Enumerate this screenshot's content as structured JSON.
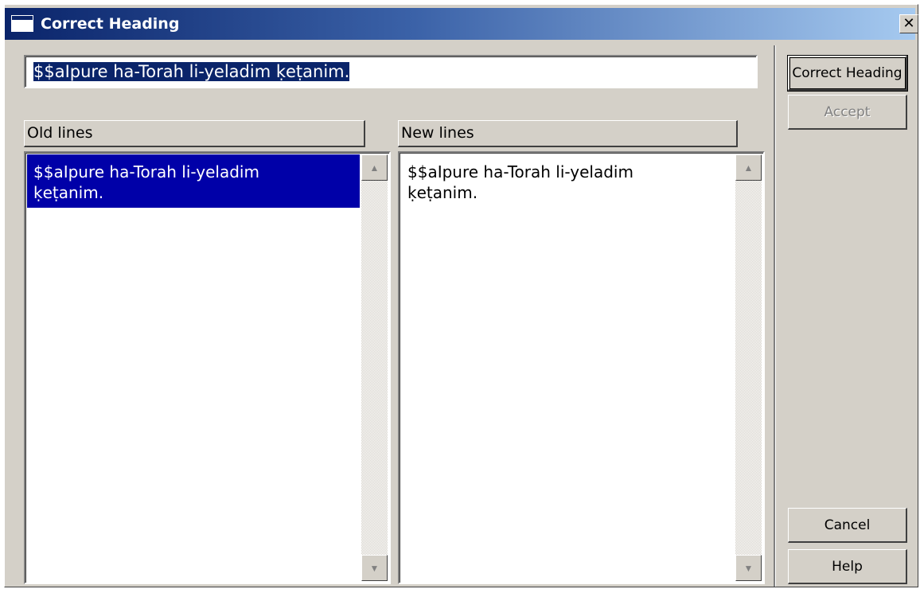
{
  "window": {
    "title": "Correct Heading",
    "close_label": "✕"
  },
  "heading_input": {
    "value": "$$aIpure ha-Torah li-yeladim ḳeṭanim."
  },
  "old_lines": {
    "header": "Old lines",
    "items": [
      "$$aIpure ha-Torah li-yeladim\nḳeṭanim."
    ]
  },
  "new_lines": {
    "header": "New lines",
    "items": [
      "$$aIpure ha-Torah li-yeladim\nḳeṭanim."
    ]
  },
  "scrollbar": {
    "up_arrow": "▲",
    "down_arrow": "▼"
  },
  "buttons": {
    "correct_heading": "Correct Heading",
    "accept": "Accept",
    "cancel": "Cancel",
    "help": "Help"
  },
  "colors": {
    "title_start": "#0a246a",
    "title_end": "#a6caf0",
    "selection": "#0000a8",
    "face": "#d4d0c8"
  }
}
